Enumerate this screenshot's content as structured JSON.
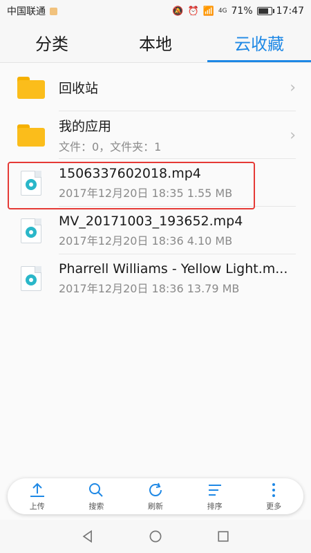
{
  "status_bar": {
    "carrier": "中国联通",
    "signal_label": "4G",
    "battery_text": "71%",
    "battery_level": 0.71,
    "time": "17:47"
  },
  "tabs": [
    {
      "label": "分类",
      "active": false
    },
    {
      "label": "本地",
      "active": false
    },
    {
      "label": "云收藏",
      "active": true
    }
  ],
  "list": [
    {
      "type": "folder",
      "title": "回收站",
      "subtitle": ""
    },
    {
      "type": "folder",
      "title": "我的应用",
      "subtitle": "文件：0，文件夹：1"
    },
    {
      "type": "video",
      "title": "1506337602018.mp4",
      "subtitle": "2017年12月20日 18:35 1.55 MB",
      "highlighted": true
    },
    {
      "type": "video",
      "title": "MV_20171003_193652.mp4",
      "subtitle": "2017年12月20日 18:36 4.10 MB"
    },
    {
      "type": "video",
      "title": "Pharrell Williams - Yellow Light.m...",
      "subtitle": "2017年12月20日 18:36 13.79 MB"
    }
  ],
  "toolbar": {
    "upload": "上传",
    "search": "搜索",
    "refresh": "刷新",
    "sort": "排序",
    "more": "更多"
  },
  "colors": {
    "accent": "#1e88e5",
    "highlight": "#e53935",
    "folder": "#fbbd1b"
  }
}
